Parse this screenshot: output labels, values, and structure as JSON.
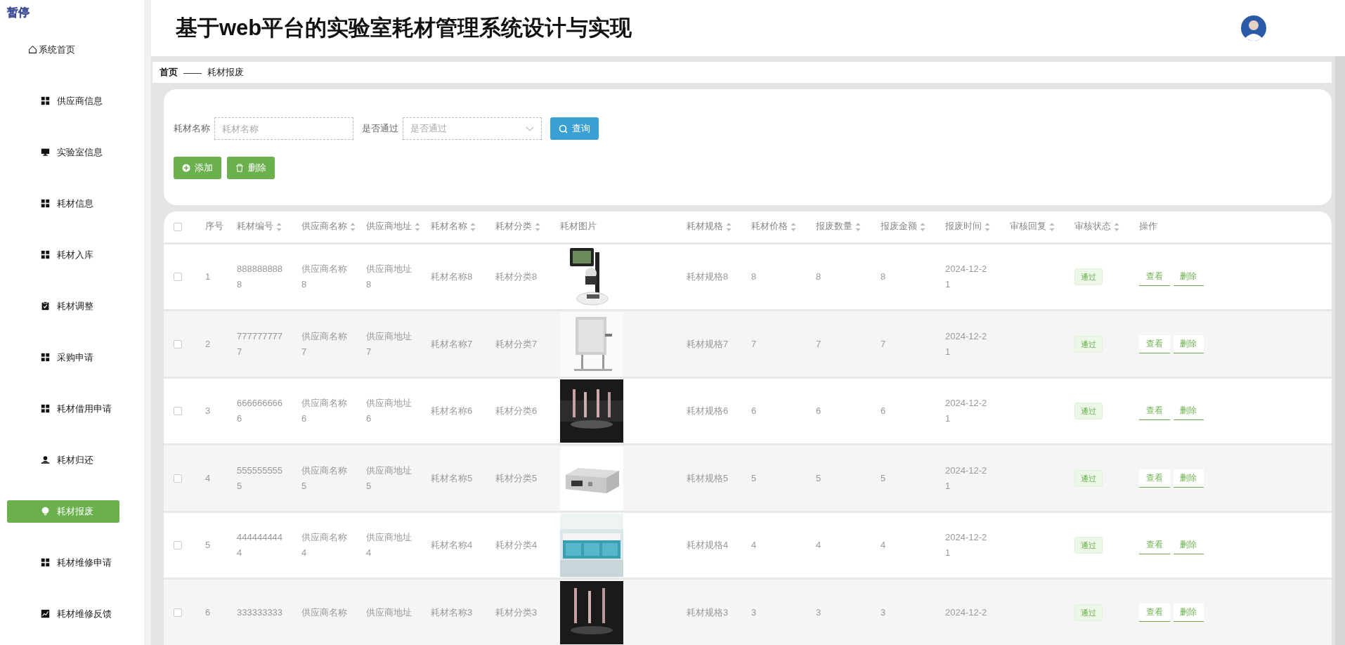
{
  "logo": "暂停",
  "header": {
    "title": "基于web平台的实验室耗材管理系统设计与实现"
  },
  "sidebar": {
    "items": [
      {
        "label": "系统首页",
        "selected": false
      },
      {
        "label": "供应商信息",
        "selected": false
      },
      {
        "label": "实验室信息",
        "selected": false
      },
      {
        "label": "耗材信息",
        "selected": false
      },
      {
        "label": "耗材入库",
        "selected": false
      },
      {
        "label": "耗材调整",
        "selected": false
      },
      {
        "label": "采购申请",
        "selected": false
      },
      {
        "label": "耗材借用申请",
        "selected": false
      },
      {
        "label": "耗材归还",
        "selected": false
      },
      {
        "label": "耗材报废",
        "selected": true
      },
      {
        "label": "耗材维修申请",
        "selected": false
      },
      {
        "label": "耗材维修反馈",
        "selected": false
      }
    ]
  },
  "breadcrumb": {
    "home": "首页",
    "separator": "——",
    "current": "耗材报废"
  },
  "filters": [
    {
      "kind": "input",
      "label": "耗材名称",
      "placeholder": "耗材名称"
    },
    {
      "kind": "select",
      "label": "是否通过",
      "placeholder": "是否通过"
    }
  ],
  "search_button": "查询",
  "actions": [
    {
      "kind": "add",
      "label": "添加"
    },
    {
      "kind": "delete",
      "label": "删除"
    }
  ],
  "table": {
    "header_checked": false,
    "columns": [
      {
        "label": "序号",
        "sortable": false
      },
      {
        "label": "耗材编号",
        "sortable": true
      },
      {
        "label": "供应商名称",
        "sortable": true
      },
      {
        "label": "供应商地址",
        "sortable": true
      },
      {
        "label": "耗材名称",
        "sortable": true
      },
      {
        "label": "耗材分类",
        "sortable": true
      },
      {
        "label": "耗材图片",
        "sortable": false
      },
      {
        "label": "耗材规格",
        "sortable": true
      },
      {
        "label": "耗材价格",
        "sortable": true
      },
      {
        "label": "报废数量",
        "sortable": true
      },
      {
        "label": "报废金额",
        "sortable": true
      },
      {
        "label": "报废时间",
        "sortable": true
      },
      {
        "label": "审核回复",
        "sortable": true
      },
      {
        "label": "审核状态",
        "sortable": true
      },
      {
        "label": "操作",
        "sortable": false
      }
    ],
    "rows": [
      {
        "checked": false,
        "seq": "1",
        "code": "8888888888",
        "supplier": "供应商名称8",
        "address": "供应商地址8",
        "name": "耗材名称8",
        "category": "耗材分类8",
        "spec": "耗材规格8",
        "price": "8",
        "quantity": "8",
        "amount": "8",
        "time": "2024-12-21",
        "status": "通过",
        "actions": [
          "查看",
          "删除"
        ]
      },
      {
        "checked": false,
        "seq": "2",
        "code": "7777777777",
        "supplier": "供应商名称7",
        "address": "供应商地址7",
        "name": "耗材名称7",
        "category": "耗材分类7",
        "spec": "耗材规格7",
        "price": "7",
        "quantity": "7",
        "amount": "7",
        "time": "2024-12-21",
        "status": "通过",
        "actions": [
          "查看",
          "删除"
        ]
      },
      {
        "checked": false,
        "seq": "3",
        "code": "6666666666",
        "supplier": "供应商名称6",
        "address": "供应商地址6",
        "name": "耗材名称6",
        "category": "耗材分类6",
        "spec": "耗材规格6",
        "price": "6",
        "quantity": "6",
        "amount": "6",
        "time": "2024-12-21",
        "status": "通过",
        "actions": [
          "查看",
          "删除"
        ]
      },
      {
        "checked": false,
        "seq": "4",
        "code": "5555555555",
        "supplier": "供应商名称5",
        "address": "供应商地址5",
        "name": "耗材名称5",
        "category": "耗材分类5",
        "spec": "耗材规格5",
        "price": "5",
        "quantity": "5",
        "amount": "5",
        "time": "2024-12-21",
        "status": "通过",
        "actions": [
          "查看",
          "删除"
        ]
      },
      {
        "checked": false,
        "seq": "5",
        "code": "4444444444",
        "supplier": "供应商名称4",
        "address": "供应商地址4",
        "name": "耗材名称4",
        "category": "耗材分类4",
        "spec": "耗材规格4",
        "price": "4",
        "quantity": "4",
        "amount": "4",
        "time": "2024-12-21",
        "status": "通过",
        "actions": [
          "查看",
          "删除"
        ]
      },
      {
        "checked": false,
        "seq": "6",
        "code": "333333333",
        "supplier": "供应商名称",
        "address": "供应商地址",
        "name": "耗材名称3",
        "category": "耗材分类3",
        "spec": "耗材规格3",
        "price": "3",
        "quantity": "3",
        "amount": "3",
        "time": "2024-12-2",
        "status": "通过",
        "actions": [
          "查看",
          "删除"
        ]
      }
    ]
  }
}
